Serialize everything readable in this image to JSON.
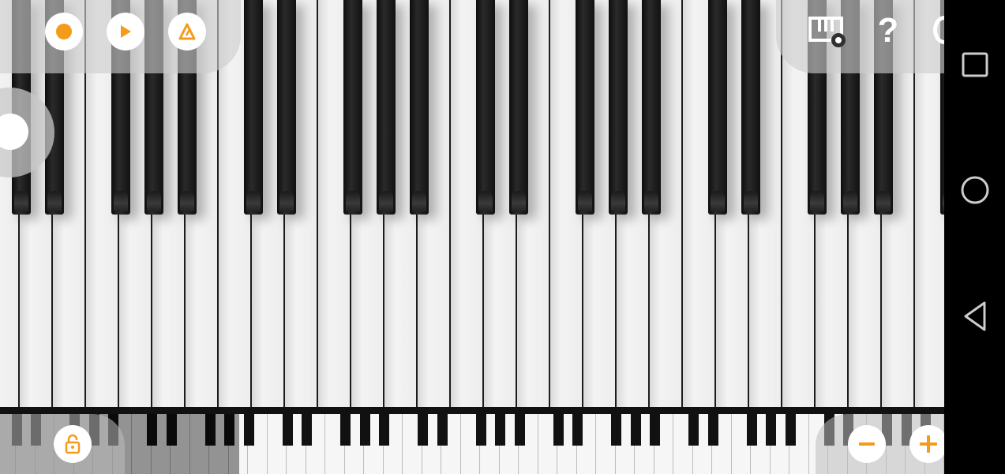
{
  "app": {
    "toolbar_left": {
      "buttons": [
        {
          "name": "record-button",
          "icon": "record-dot-icon"
        },
        {
          "name": "play-button",
          "icon": "play-triangle-icon"
        },
        {
          "name": "metronome-button",
          "icon": "metronome-icon"
        }
      ]
    },
    "toolbar_right": {
      "settings_icon": "keyboard-settings-icon",
      "help_label": "?"
    },
    "zoom": {
      "minus_icon": "minus-icon",
      "plus_icon": "plus-icon"
    },
    "lock_icon": "lock-icon",
    "accent_color": "#f49b1a"
  },
  "navbar": {
    "buttons": [
      "recent-apps-icon",
      "home-icon",
      "back-icon"
    ]
  }
}
